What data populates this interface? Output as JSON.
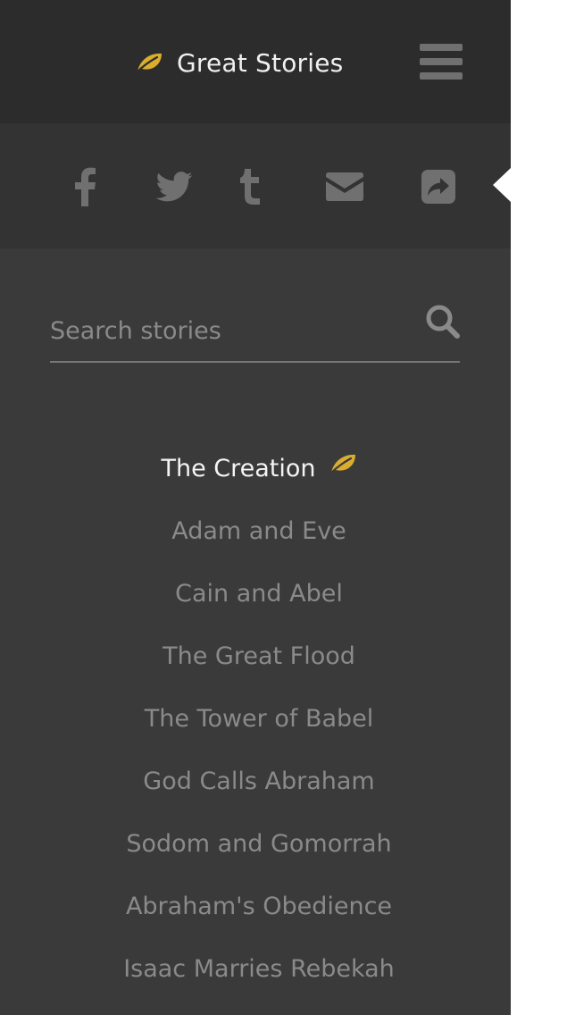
{
  "header": {
    "title": "Great Stories",
    "logo_icon": "leaf-icon",
    "menu_icon": "hamburger-menu-icon"
  },
  "share": {
    "items": [
      {
        "name": "facebook",
        "icon": "facebook-icon"
      },
      {
        "name": "twitter",
        "icon": "twitter-icon"
      },
      {
        "name": "tumblr",
        "icon": "tumblr-icon"
      },
      {
        "name": "email",
        "icon": "email-icon"
      },
      {
        "name": "share",
        "icon": "share-icon"
      }
    ]
  },
  "search": {
    "placeholder": "Search stories",
    "value": "",
    "icon": "search-icon"
  },
  "stories": {
    "items": [
      {
        "label": "The Creation",
        "active": true
      },
      {
        "label": "Adam and Eve",
        "active": false
      },
      {
        "label": "Cain and Abel",
        "active": false
      },
      {
        "label": "The Great Flood",
        "active": false
      },
      {
        "label": "The Tower of Babel",
        "active": false
      },
      {
        "label": "God Calls Abraham",
        "active": false
      },
      {
        "label": "Sodom and Gomorrah",
        "active": false
      },
      {
        "label": "Abraham's Obedience",
        "active": false
      },
      {
        "label": "Isaac Marries Rebekah",
        "active": false
      }
    ]
  },
  "colors": {
    "accent": "#d9ad2e",
    "panel": "#3a3a3a",
    "topbar": "#2c2c2c",
    "shareband": "#333333",
    "icon": "#707070",
    "active_text": "#f4f4f4",
    "inactive_text": "#8a8a8a"
  }
}
